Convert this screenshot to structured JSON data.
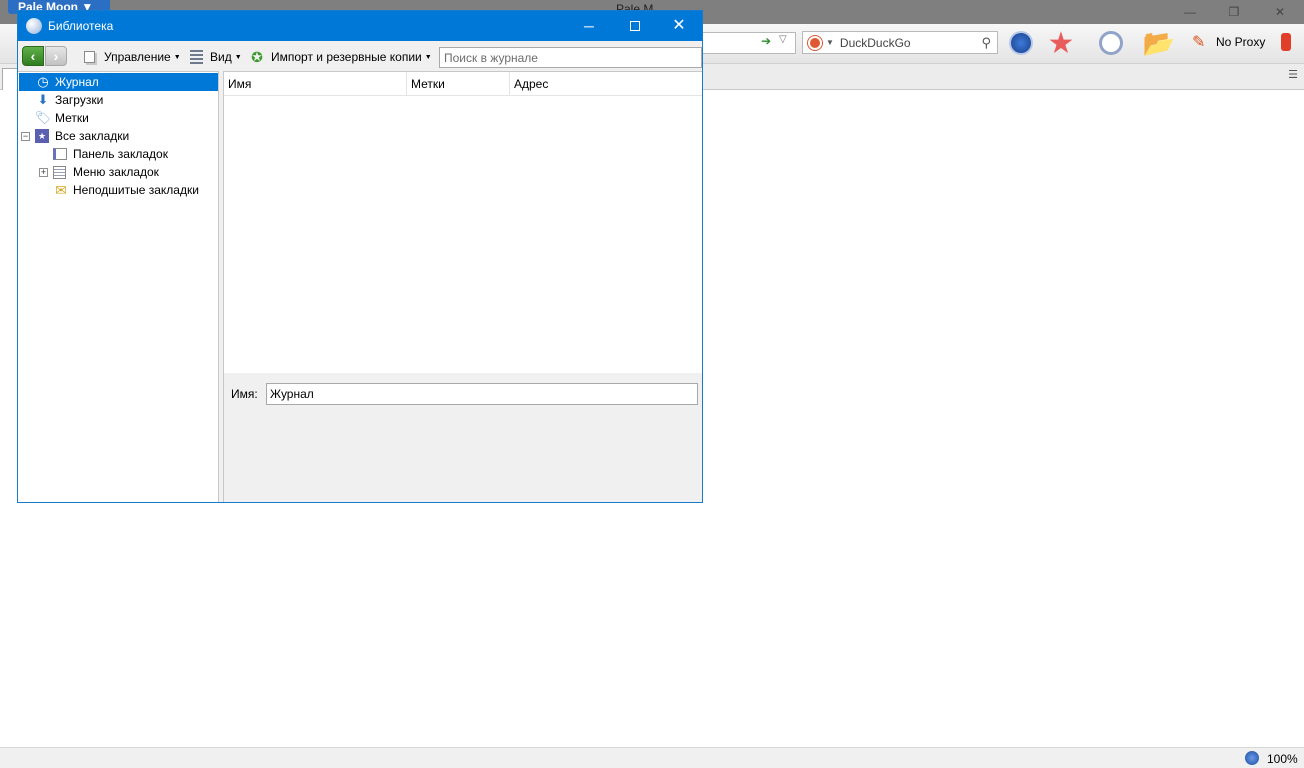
{
  "browser": {
    "app_menu_label": "Pale Moon ▼",
    "title": "Pale M",
    "search_engine_name": "DuckDuckGo",
    "proxy_label": "No Proxy",
    "status_zoom": "100%"
  },
  "library": {
    "title": "Библиотека",
    "toolbar": {
      "organize_label": "Управление",
      "views_label": "Вид",
      "import_label": "Импорт и резервные копии",
      "search_placeholder": "Поиск в журнале"
    },
    "tree": [
      {
        "label": "Журнал",
        "icon": "clock-icon",
        "selected": true
      },
      {
        "label": "Загрузки",
        "icon": "download-arrow-icon"
      },
      {
        "label": "Метки",
        "icon": "tag-icon"
      },
      {
        "label": "Все закладки",
        "icon": "all-bookmarks-icon",
        "expanded": true
      },
      {
        "label": "Панель закладок",
        "icon": "bookmarks-toolbar-icon"
      },
      {
        "label": "Меню закладок",
        "icon": "bookmarks-menu-icon",
        "collapsed": true
      },
      {
        "label": "Неподшитые закладки",
        "icon": "unsorted-bookmarks-icon"
      }
    ],
    "columns": [
      "Имя",
      "Метки",
      "Адрес"
    ],
    "details": {
      "name_label": "Имя:",
      "name_value": "Журнал"
    }
  },
  "colors": {
    "titlebar_accent": "#0078d7",
    "selection": "#0078d7",
    "back_button": "#3f9a2c"
  }
}
